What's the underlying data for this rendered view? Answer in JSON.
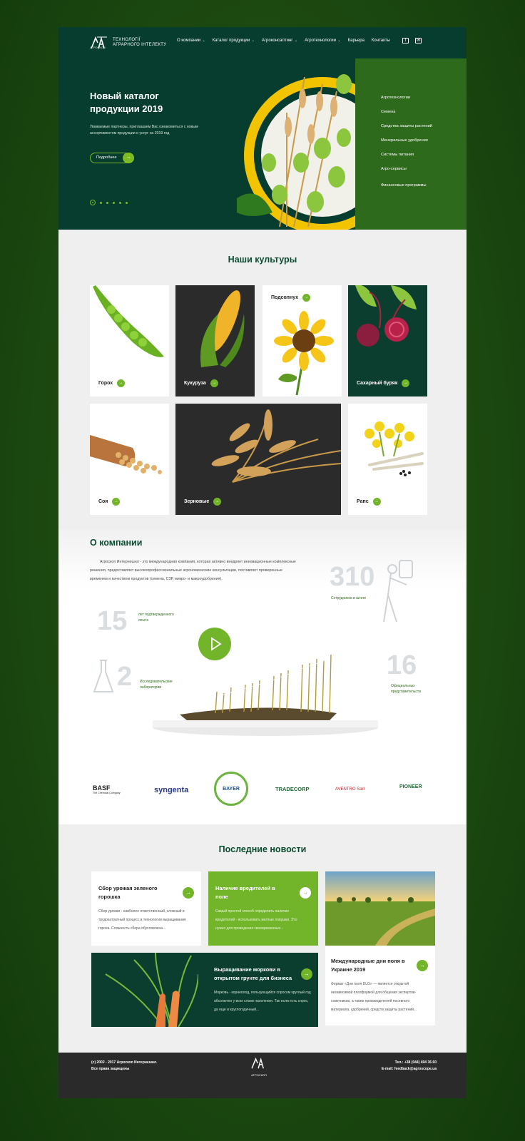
{
  "header": {
    "logo_line1": "ТЕХНОЛОГІЇ",
    "logo_line2": "АГРАРНОГО ІНТЕЛЕКТУ",
    "logo_sub": "АГРОСКОП",
    "nav": [
      {
        "label": "О компании",
        "dropdown": true
      },
      {
        "label": "Каталог продукции",
        "dropdown": true
      },
      {
        "label": "Агроконсалтинг",
        "dropdown": true
      },
      {
        "label": "Агротехнологии",
        "dropdown": true
      },
      {
        "label": "Карьера",
        "dropdown": false
      },
      {
        "label": "Контакты",
        "dropdown": false
      }
    ],
    "social_icons": [
      "facebook-icon",
      "mail-icon"
    ]
  },
  "hero": {
    "title": "Новый каталог продукции 2019",
    "text": "Уважаемые партнеры, приглашаем Вас ознакомиться с новым ассортиментом продукции и услуг на 2019 год",
    "button_label": "Подробнее",
    "slides_count": 6,
    "active_slide": 1,
    "side_menu": [
      "Агротехнологии",
      "Семена",
      "Средства защиты растений",
      "Минеральные удобрения",
      "Системы питания",
      "Агро-сервисы",
      "Финансовые программы"
    ]
  },
  "cultures": {
    "title": "Наши культуры",
    "items": [
      "Горох",
      "Кукуруза",
      "Подсолнух",
      "Сахарный буряк",
      "Соя",
      "Зерновые",
      "Рапс"
    ]
  },
  "about": {
    "title": "О компании",
    "text": "Агроскоп Интернешнл - это международная компания, которая активно внедряет инновационные комплексные решения, предоставляет высокопрофессиональные агрономические консультации, поставляет проверенные временем и качеством продуктов (семена, СЗР, микро- и макроудобрения).",
    "stats": [
      {
        "value": "310",
        "label": "Сотрудников в штате"
      },
      {
        "value": "15",
        "label": "лет подтвержденного опыта"
      },
      {
        "value": "2",
        "label": "Исследовательские лаборатории"
      },
      {
        "value": "16",
        "label": "Официальных представительств"
      }
    ],
    "partners": [
      "BASF",
      "The Chemical Company",
      "syngenta",
      "BAYER",
      "TRADECORP",
      "AVENTRO Sarl",
      "PIONEER"
    ]
  },
  "news": {
    "title": "Последние новости",
    "items": [
      {
        "title": "Сбор урожая зеленого горошка",
        "text": "Сбор урожая - наиболее ответственный, сложный и трудозатратный процесс в технологии выращивания гороха. Сложность сбора обусловлена..."
      },
      {
        "title": "Наличие вредителей в поле",
        "text": "Самый простой способ определить наличие вредителей - использовать желтые ловушки. Это нужно для проведения своевременных..."
      },
      {
        "title": "Международные дни поля в Украине 2019",
        "text": "Формат «Дни поля DLG» — является открытой независимой платформой для общения экспертов-советников, а также производителей посевного материала, удобрений, средств защиты растений..."
      },
      {
        "title": "Выращивание моркови в открытом грунте для бизнеса",
        "text": "Морковь - корнеплод, пользующийся спросом круглый год абсолютно у всех слоев населения. Так если есть спрос, да еще и круглогодичный..."
      }
    ]
  },
  "footer": {
    "copyright": "(с) 2002 - 2017 Агроскоп Интернешнл.",
    "rights": "Все права защищены",
    "logo": "АГРОСКОП",
    "phone": "Тел.: +38 (044) 494 36 60",
    "email": "E-mail: feedback@agroscope.ua"
  },
  "colors": {
    "dark_green": "#063d2e",
    "accent_green": "#72b52a",
    "side_green": "#2e6a1c",
    "yellow": "#f2c400"
  }
}
